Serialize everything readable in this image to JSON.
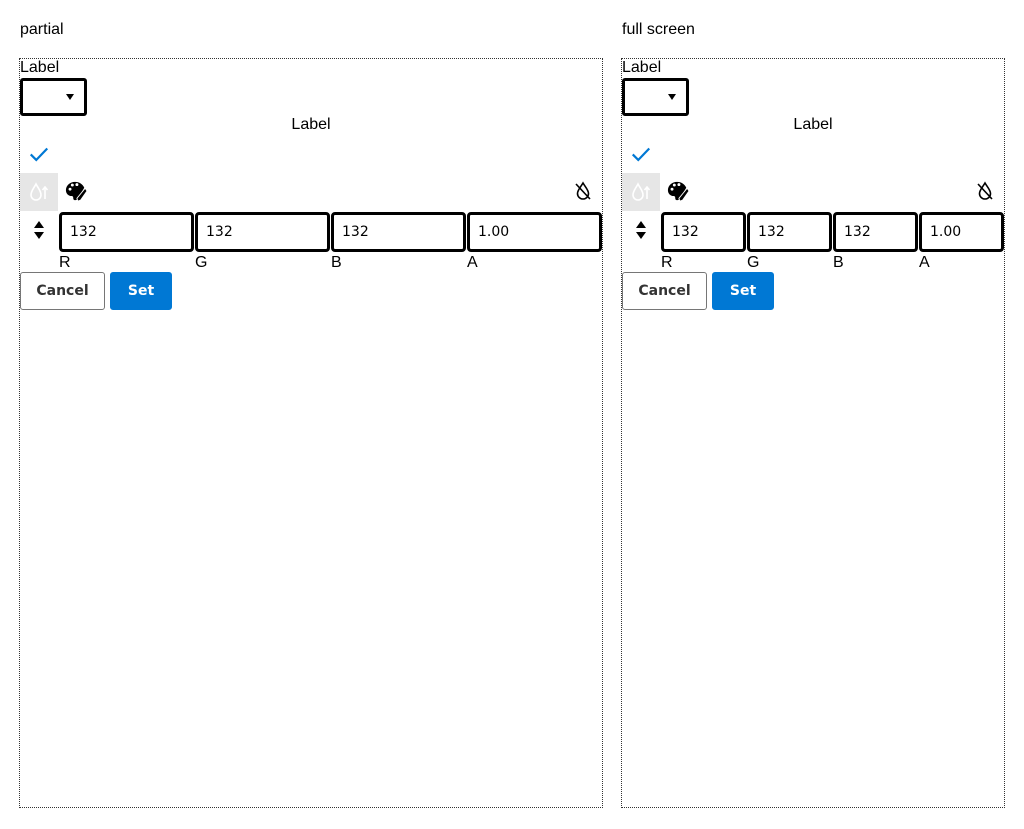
{
  "panels": [
    {
      "title": "partial",
      "field_label": "Label",
      "picker_title": "Label",
      "channels": [
        {
          "label": "R",
          "value": "132"
        },
        {
          "label": "G",
          "value": "132"
        },
        {
          "label": "B",
          "value": "132"
        },
        {
          "label": "A",
          "value": "1.00"
        }
      ],
      "cancel_label": "Cancel",
      "set_label": "Set"
    },
    {
      "title": "full screen",
      "field_label": "Label",
      "picker_title": "Label",
      "channels": [
        {
          "label": "R",
          "value": "132"
        },
        {
          "label": "G",
          "value": "132"
        },
        {
          "label": "B",
          "value": "132"
        },
        {
          "label": "A",
          "value": "1.00"
        }
      ],
      "cancel_label": "Cancel",
      "set_label": "Set"
    }
  ],
  "colors": {
    "accent": "#0078d4",
    "eyedropper_bg": "#e6e6e6"
  },
  "icons": [
    "check-icon",
    "eyedropper-icon",
    "palette-icon",
    "no-drop-icon",
    "sort-stepper-icon"
  ]
}
